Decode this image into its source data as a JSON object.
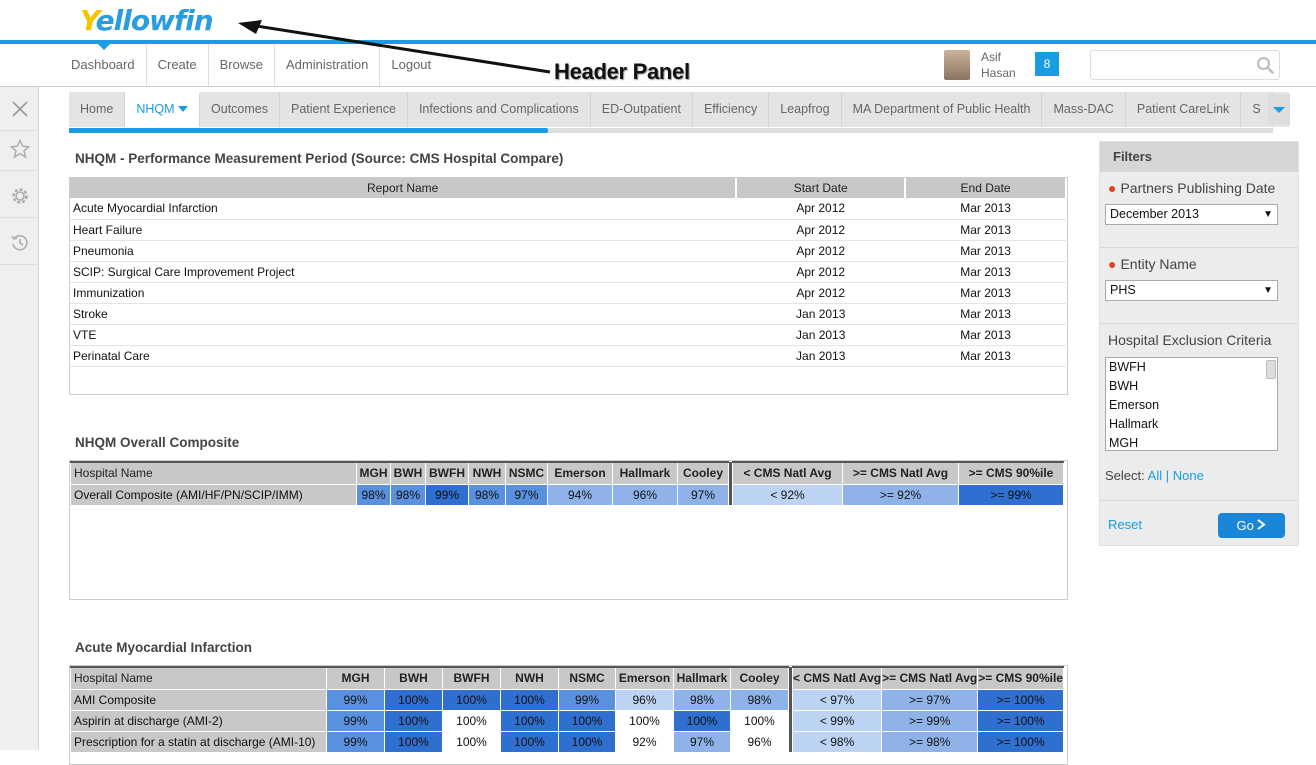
{
  "header": {
    "logo_prefix": "Y",
    "logo_rest": "ellowfin",
    "nav": [
      "Dashboard",
      "Create",
      "Browse",
      "Administration",
      "Logout"
    ],
    "user_first": "Asif",
    "user_last": "Hasan",
    "notifications": "8",
    "search_placeholder": ""
  },
  "annotation": {
    "label": "Header Panel"
  },
  "tabs": {
    "items": [
      "Home",
      "NHQM",
      "Outcomes",
      "Patient Experience",
      "Infections and Complications",
      "ED-Outpatient",
      "Efficiency",
      "Leapfrog",
      "MA Department of Public Health",
      "Mass-DAC",
      "Patient CareLink",
      "S"
    ],
    "active": "NHQM",
    "scroll_progress": 0.398
  },
  "report": {
    "title": "NHQM - Performance Measurement Period (Source: CMS Hospital Compare)",
    "columns": [
      "Report Name",
      "Start Date",
      "End Date"
    ],
    "rows": [
      [
        "Acute Myocardial Infarction",
        "Apr 2012",
        "Mar 2013"
      ],
      [
        "Heart Failure",
        "Apr 2012",
        "Mar 2013"
      ],
      [
        "Pneumonia",
        "Apr 2012",
        "Mar 2013"
      ],
      [
        "SCIP: Surgical Care Improvement Project",
        "Apr 2012",
        "Mar 2013"
      ],
      [
        "Immunization",
        "Apr 2012",
        "Mar 2013"
      ],
      [
        "Stroke",
        "Jan 2013",
        "Mar 2013"
      ],
      [
        "VTE",
        "Jan 2013",
        "Mar 2013"
      ],
      [
        "Perinatal Care",
        "Jan 2013",
        "Mar 2013"
      ]
    ]
  },
  "composite": {
    "title": "NHQM Overall Composite",
    "columns": [
      "Hospital Name",
      "MGH",
      "BWH",
      "BWFH",
      "NWH",
      "NSMC",
      "Emerson",
      "Hallmark",
      "Cooley"
    ],
    "legend_columns": [
      "< CMS Natl Avg",
      ">= CMS Natl Avg",
      ">= CMS 90%ile"
    ],
    "rows": [
      {
        "name": "Overall Composite (AMI/HF/PN/SCIP/IMM)",
        "values": [
          "98%",
          "98%",
          "99%",
          "98%",
          "97%",
          "94%",
          "96%",
          "97%"
        ],
        "shades": [
          "c2",
          "c2",
          "c1",
          "c2",
          "c2",
          "c3",
          "c3",
          "c3"
        ],
        "legend": [
          "< 92%",
          ">= 92%",
          ">= 99%"
        ]
      }
    ]
  },
  "ami": {
    "title": "Acute Myocardial Infarction",
    "columns": [
      "Hospital Name",
      "MGH",
      "BWH",
      "BWFH",
      "NWH",
      "NSMC",
      "Emerson",
      "Hallmark",
      "Cooley"
    ],
    "legend_columns": [
      "< CMS Natl Avg",
      ">= CMS Natl Avg",
      ">= CMS 90%ile"
    ],
    "rows": [
      {
        "name": "AMI Composite",
        "values": [
          "99%",
          "100%",
          "100%",
          "100%",
          "99%",
          "96%",
          "98%",
          "98%"
        ],
        "shades": [
          "c2",
          "c1",
          "c1",
          "c1",
          "c2",
          "c4",
          "c3",
          "c3"
        ],
        "legend": [
          "< 97%",
          ">= 97%",
          ">= 100%"
        ]
      },
      {
        "name": "Aspirin at discharge (AMI-2)",
        "values": [
          "99%",
          "100%",
          "100%",
          "100%",
          "100%",
          "100%",
          "100%",
          "100%"
        ],
        "shades": [
          "c2",
          "c1",
          "cw",
          "c1",
          "c1",
          "cw",
          "c1",
          "cw"
        ],
        "legend": [
          "< 99%",
          ">= 99%",
          ">= 100%"
        ]
      },
      {
        "name": "Prescription for a statin at discharge (AMI-10)",
        "values": [
          "99%",
          "100%",
          "100%",
          "100%",
          "100%",
          "92%",
          "97%",
          "96%"
        ],
        "shades": [
          "c2",
          "c1",
          "cw",
          "c1",
          "c1",
          "cw",
          "c3",
          "cw"
        ],
        "legend": [
          "< 98%",
          ">= 98%",
          ">= 100%"
        ]
      }
    ]
  },
  "legend_shades": [
    "c4",
    "c3",
    "c1"
  ],
  "filters": {
    "title": "Filters",
    "partners_label": "Partners Publishing Date",
    "partners_value": "December 2013",
    "entity_label": "Entity Name",
    "entity_value": "PHS",
    "exclusion_label": "Hospital Exclusion Criteria",
    "exclusion_items": [
      "BWFH",
      "BWH",
      "Emerson",
      "Hallmark",
      "MGH"
    ],
    "select_prefix": "Select:",
    "select_all": "All",
    "select_divider": "|",
    "select_none": "None",
    "reset": "Reset",
    "go": "Go"
  }
}
